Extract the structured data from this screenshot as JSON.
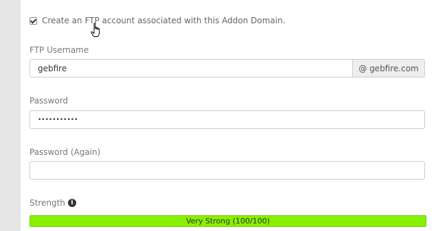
{
  "ftp_option": {
    "label": "Create an FTP account associated with this Addon Domain.",
    "checked": true
  },
  "username": {
    "label": "FTP Username",
    "value": "gebfire",
    "domain_suffix": "@ gebfire.com"
  },
  "password": {
    "label": "Password",
    "value": "•••••••••••"
  },
  "password_again": {
    "label": "Password (Again)",
    "value": ""
  },
  "strength": {
    "label": "Strength",
    "icon": "info-icon",
    "meter_text": "Very Strong (100/100)",
    "score": 100,
    "max": 100,
    "color": "#88f000"
  },
  "colors": {
    "left_rail": "#e6e6e6",
    "field_border": "#cccccc",
    "addon_bg": "#eeeeee"
  }
}
